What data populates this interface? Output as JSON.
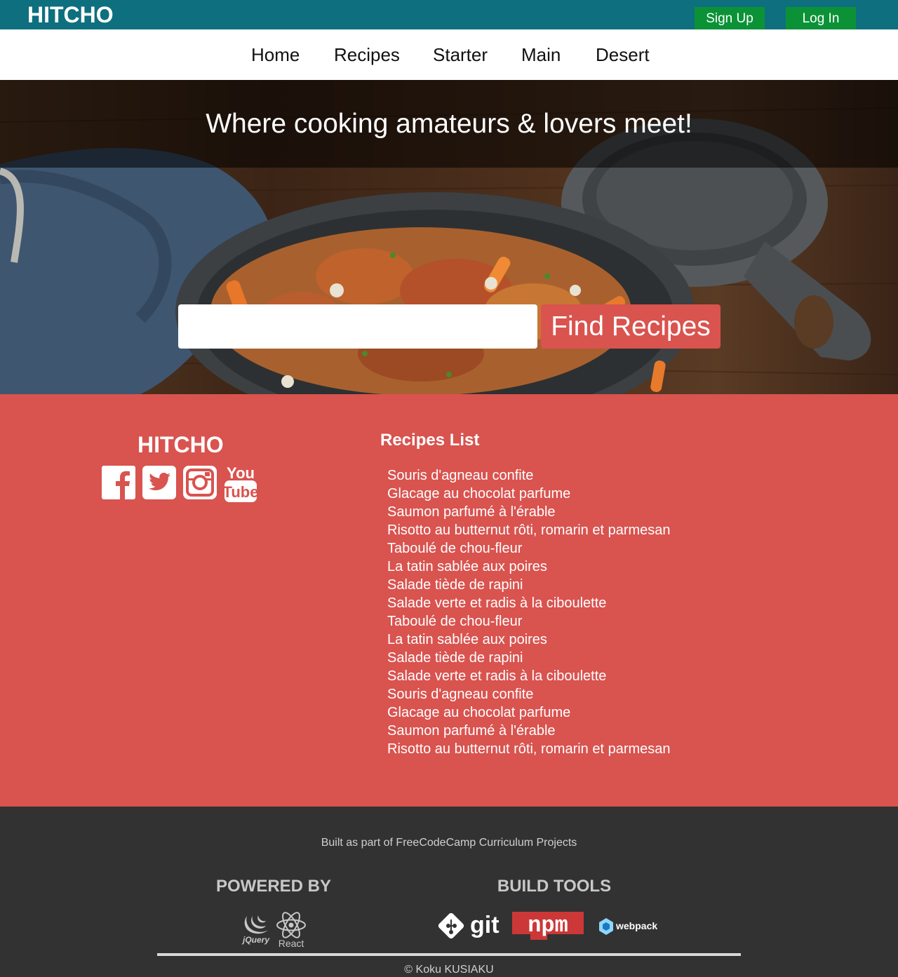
{
  "header": {
    "brand": "HITCHO",
    "signup_label": "Sign Up",
    "login_label": "Log In"
  },
  "nav": {
    "items": [
      {
        "label": "Home"
      },
      {
        "label": "Recipes"
      },
      {
        "label": "Starter"
      },
      {
        "label": "Main"
      },
      {
        "label": "Desert"
      }
    ]
  },
  "hero": {
    "tagline": "Where cooking amateurs & lovers meet!",
    "search_placeholder": "",
    "search_value": "",
    "find_label": "Find Recipes"
  },
  "info": {
    "brand": "HITCHO",
    "social": [
      {
        "icon": "facebook-icon"
      },
      {
        "icon": "twitter-icon"
      },
      {
        "icon": "instagram-icon"
      },
      {
        "icon": "youtube-icon"
      }
    ],
    "list_title": "Recipes List",
    "recipes": [
      "Souris d'agneau confite",
      "Glacage au chocolat parfume",
      "Saumon parfumé à l'érable",
      "Risotto au butternut rôti, romarin et parmesan",
      "Taboulé de chou-fleur",
      "La tatin sablée aux poires",
      "Salade tiède de rapini",
      "Salade verte et radis à la ciboulette",
      "Taboulé de chou-fleur",
      "La tatin sablée aux poires",
      "Salade tiède de rapini",
      "Salade verte et radis à la ciboulette",
      "Souris d'agneau confite",
      "Glacage au chocolat parfume",
      "Saumon parfumé à l'érable",
      "Risotto au butternut rôti, romarin et parmesan"
    ]
  },
  "footer": {
    "built_text": "Built as part of FreeCodeCamp Curriculum Projects",
    "powered_title": "POWERED BY",
    "build_title": "BUILD TOOLS",
    "jquery_text": "jQuery",
    "react_text": "React",
    "git_text": "git",
    "npm_text": "npm",
    "webpack_text": "webpack",
    "copyright": "© Koku KUSIAKU"
  },
  "colors": {
    "topbar": "#0e6f7e",
    "auth_button": "#0b9237",
    "accent_red": "#d9534f",
    "footer": "#323232"
  }
}
